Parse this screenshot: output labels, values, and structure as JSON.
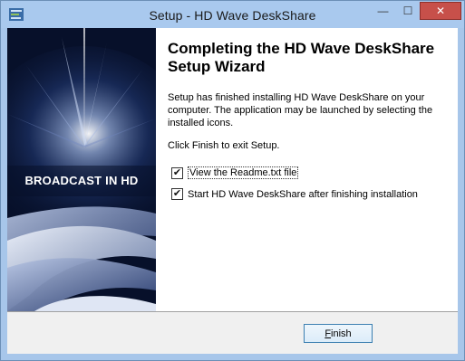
{
  "window": {
    "title": "Setup - HD Wave DeskShare",
    "minimize_glyph": "—",
    "maximize_glyph": "☐",
    "close_glyph": "✕"
  },
  "banner": {
    "text": "BROADCAST IN HD"
  },
  "content": {
    "heading": "Completing the HD Wave DeskShare Setup Wizard",
    "paragraph1": "Setup has finished installing HD Wave DeskShare on your computer. The application may be launched by selecting the installed icons.",
    "paragraph2": "Click Finish to exit Setup.",
    "options": [
      {
        "label": "View the Readme.txt file",
        "checked": true
      },
      {
        "label": "Start HD Wave DeskShare after finishing installation",
        "checked": true
      }
    ]
  },
  "buttons": {
    "finish_mnemonic": "F",
    "finish_rest": "inish"
  },
  "colors": {
    "titlebar": "#a9c9ee",
    "banner_bg": "#07102a",
    "close_button": "#c7504a",
    "button_border": "#3c7fb1"
  },
  "icons": {
    "app": "setup-app-icon",
    "check": "✔"
  }
}
